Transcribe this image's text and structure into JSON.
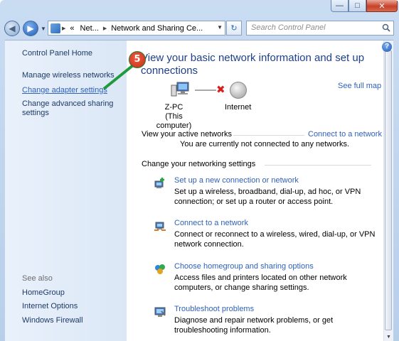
{
  "window": {
    "controls": {
      "minimize": "—",
      "maximize": "□",
      "close": "✕"
    }
  },
  "nav": {
    "back_icon": "◀",
    "forward_icon": "▶",
    "history_icon": "▼",
    "address_segments": [
      "«",
      "Net...",
      "Network and Sharing Ce..."
    ],
    "address_separator": "▶",
    "address_dropdown": "▼",
    "refresh_icon": "↻",
    "search_placeholder": "Search Control Panel"
  },
  "sidebar": {
    "home": "Control Panel Home",
    "items": [
      {
        "label": "Manage wireless networks"
      },
      {
        "label": "Change adapter settings"
      },
      {
        "label": "Change advanced sharing settings"
      }
    ],
    "see_also_header": "See also",
    "see_also": [
      {
        "label": "HomeGroup"
      },
      {
        "label": "Internet Options"
      },
      {
        "label": "Windows Firewall"
      }
    ]
  },
  "main": {
    "help_label": "?",
    "title": "View your basic network information and set up connections",
    "see_full_map": "See full map",
    "map": {
      "computer_name": "Z-PC",
      "computer_caption": "(This computer)",
      "internet_label": "Internet",
      "disconnect_mark": "✖"
    },
    "active_networks": {
      "header": "View your active networks",
      "connect_link": "Connect to a network",
      "status": "You are currently not connected to any networks."
    },
    "change_settings_header": "Change your networking settings",
    "tasks": [
      {
        "link": "Set up a new connection or network",
        "desc": "Set up a wireless, broadband, dial-up, ad hoc, or VPN connection; or set up a router or access point."
      },
      {
        "link": "Connect to a network",
        "desc": "Connect or reconnect to a wireless, wired, dial-up, or VPN network connection."
      },
      {
        "link": "Choose homegroup and sharing options",
        "desc": "Access files and printers located on other network computers, or change sharing settings."
      },
      {
        "link": "Troubleshoot problems",
        "desc": "Diagnose and repair network problems, or get troubleshooting information."
      }
    ]
  },
  "callout": {
    "number": "5"
  },
  "colors": {
    "link": "#2f61b8",
    "title": "#1e3f8b",
    "callout": "#1f9a3c"
  }
}
